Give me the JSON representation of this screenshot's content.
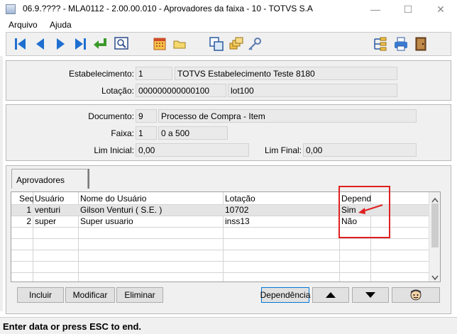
{
  "window": {
    "title": "06.9.???? - MLA0112 - 2.00.00.010 - Aprovadores da faixa - 10 - TOTVS S.A",
    "minimize_glyph": "—",
    "maximize_glyph": "☐",
    "close_glyph": "✕"
  },
  "menu": {
    "items": [
      "Arquivo",
      "Ajuda"
    ]
  },
  "toolbar": {
    "icons": [
      "first-record-icon",
      "previous-record-icon",
      "next-record-icon",
      "last-record-icon",
      "goto-icon",
      "search-icon",
      "calendar-icon",
      "folder-icon",
      "copy-icon",
      "stack-icon",
      "key-icon",
      "tree-icon",
      "print-icon",
      "exit-door-icon"
    ]
  },
  "header": {
    "estabelecimento_label": "Estabelecimento:",
    "estabelecimento_code": "1",
    "estabelecimento_name": "TOTVS Estabelecimento Teste 8180",
    "lotacao_label": "Lotação:",
    "lotacao_code": "000000000000100",
    "lotacao_name": "lot100"
  },
  "details": {
    "documento_label": "Documento:",
    "documento_code": "9",
    "documento_name": "Processo de Compra - Item",
    "faixa_label": "Faixa:",
    "faixa_code": "1",
    "faixa_range": "0  a  500",
    "lim_inicial_label": "Lim Inicial:",
    "lim_inicial_value": "0,00",
    "lim_final_label": "Lim Final:",
    "lim_final_value": "0,00"
  },
  "tab": {
    "label": "Aprovadores"
  },
  "grid": {
    "columns": {
      "seq": "Seq",
      "usuario": "Usuário",
      "nome": "Nome do Usuário",
      "lotacao": "Lotação",
      "depend": "Depend"
    },
    "rows": [
      {
        "seq": "1",
        "usuario": "venturi",
        "nome": "Gilson Venturi ( S.E. )",
        "lotacao": "10702",
        "depend": "Sim"
      },
      {
        "seq": "2",
        "usuario": "super",
        "nome": "Super usuario",
        "lotacao": "inss13",
        "depend": "Não"
      }
    ]
  },
  "buttons": {
    "incluir": "Incluir",
    "modificar": "Modificar",
    "eliminar": "Eliminar",
    "dependencia": "Dependência"
  },
  "status": {
    "text": "Enter data or press ESC to end."
  },
  "colors": {
    "highlight": "#e02020",
    "nav_blue": "#1e6fd0",
    "selected_row": "#e4e4e4"
  }
}
